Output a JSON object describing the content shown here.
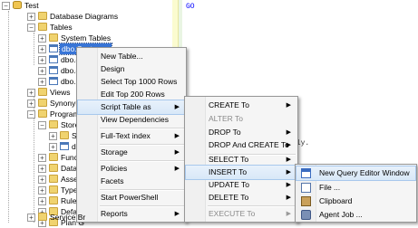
{
  "tree": {
    "root": "Test",
    "database_diagrams": "Database Diagrams",
    "tables": "Tables",
    "system_tables": "System Tables",
    "selected_table": "dbo.Customer",
    "tables_partial": [
      "dbo.em",
      "dbo.em",
      "dbo.u"
    ],
    "views": "Views",
    "synonyms": "Synonym",
    "programmability": "Programm",
    "stored": "Stored",
    "sys_sub": "Sy",
    "dbo_sub": "db",
    "functions": "Functi",
    "database": "Datab",
    "assemblies": "Assem",
    "types": "Types",
    "rules": "Rules",
    "defaults": "Defau",
    "plan_guides": "Plan G",
    "service_broker": "Service Br"
  },
  "editor": {
    "go": "GO",
    "bg_text": "lly."
  },
  "context_menu": {
    "items": [
      "New Table...",
      "Design",
      "Select Top 1000 Rows",
      "Edit Top 200 Rows",
      "Script Table as",
      "View Dependencies",
      "Full-Text index",
      "Storage",
      "Policies",
      "Facets",
      "Start PowerShell",
      "Reports"
    ]
  },
  "script_menu": {
    "items": [
      "CREATE To",
      "ALTER To",
      "DROP To",
      "DROP And CREATE To",
      "SELECT To",
      "INSERT To",
      "UPDATE To",
      "DELETE To",
      "EXECUTE To"
    ]
  },
  "insert_menu": {
    "items": [
      "New Query Editor Window",
      "File ...",
      "Clipboard",
      "Agent Job ..."
    ]
  },
  "icons": {
    "expand": "plus-box-icon",
    "collapse": "minus-box-icon",
    "submenu": "triangle-right-icon"
  },
  "colors": {
    "selection": "#3875d7",
    "menu_bg": "#f5f5f5",
    "highlight": "#d8e8f8",
    "go_keyword": "#0000ff"
  }
}
